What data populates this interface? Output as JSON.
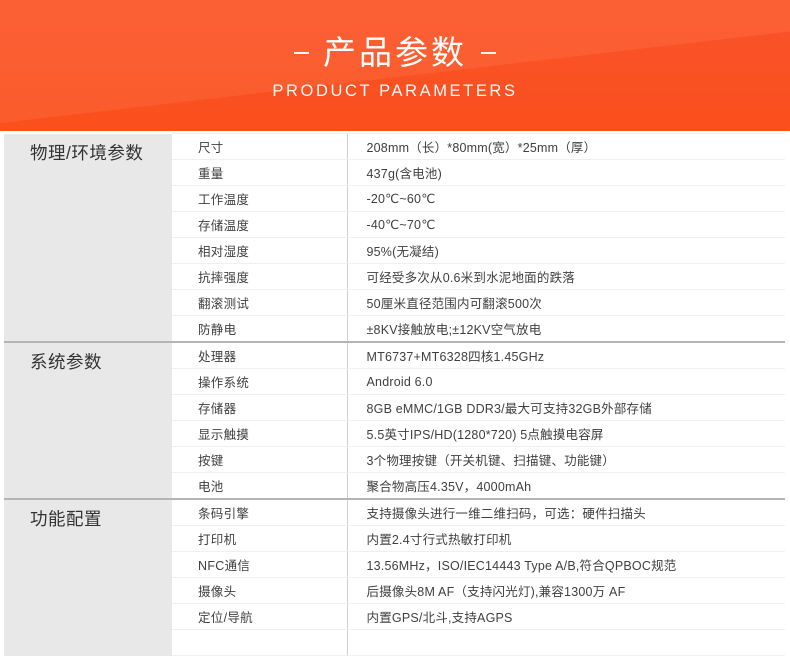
{
  "banner": {
    "title_cn": "产品参数",
    "title_en": "PRODUCT PARAMETERS",
    "dash_left": "–",
    "dash_right": "–",
    "color_start": "#f8512a",
    "color_end": "#fb4f1c",
    "text_color": "#ffffff"
  },
  "table": {
    "group_bg": "#e8e8e8",
    "row_divider": "#efefef",
    "section_divider": "#b4b4b4",
    "column_divider": "#cfcfcf",
    "sections": [
      {
        "group": "物理/环境参数",
        "rows": [
          {
            "key": "尺寸",
            "value": "208mm（长）*80mm(宽）*25mm（厚）"
          },
          {
            "key": "重量",
            "value": "437g(含电池)"
          },
          {
            "key": "工作温度",
            "value": "-20℃~60℃"
          },
          {
            "key": "存储温度",
            "value": "-40℃~70℃"
          },
          {
            "key": "相对湿度",
            "value": "95%(无凝结)"
          },
          {
            "key": "抗摔强度",
            "value": "可经受多次从0.6米到水泥地面的跌落"
          },
          {
            "key": "翻滚测试",
            "value": "50厘米直径范围内可翻滚500次"
          },
          {
            "key": "防静电",
            "value": "±8KV接触放电;±12KV空气放电"
          }
        ]
      },
      {
        "group": "系统参数",
        "rows": [
          {
            "key": "处理器",
            "value": "MT6737+MT6328四核1.45GHz"
          },
          {
            "key": "操作系统",
            "value": "Android 6.0"
          },
          {
            "key": "存储器",
            "value": "8GB eMMC/1GB DDR3/最大可支持32GB外部存储"
          },
          {
            "key": "显示触摸",
            "value": "5.5英寸IPS/HD(1280*720)   5点触摸电容屏"
          },
          {
            "key": "按键",
            "value": "3个物理按键（开关机键、扫描键、功能键）"
          },
          {
            "key": "电池",
            "value": "聚合物高压4.35V，4000mAh"
          }
        ]
      },
      {
        "group": "功能配置",
        "rows": [
          {
            "key": "条码引擎",
            "value": "支持摄像头进行一维二维扫码，可选：硬件扫描头"
          },
          {
            "key": "打印机",
            "value": "内置2.4寸行式热敏打印机"
          },
          {
            "key": "NFC通信",
            "value": "13.56MHz，ISO/IEC14443 Type A/B,符合QPBOC规范"
          },
          {
            "key": "摄像头",
            "value": "后摄像头8M AF（支持闪光灯),兼容1300万 AF"
          },
          {
            "key": "定位/导航",
            "value": "内置GPS/北斗,支持AGPS"
          },
          {
            "key": "",
            "value": ""
          }
        ]
      }
    ]
  }
}
